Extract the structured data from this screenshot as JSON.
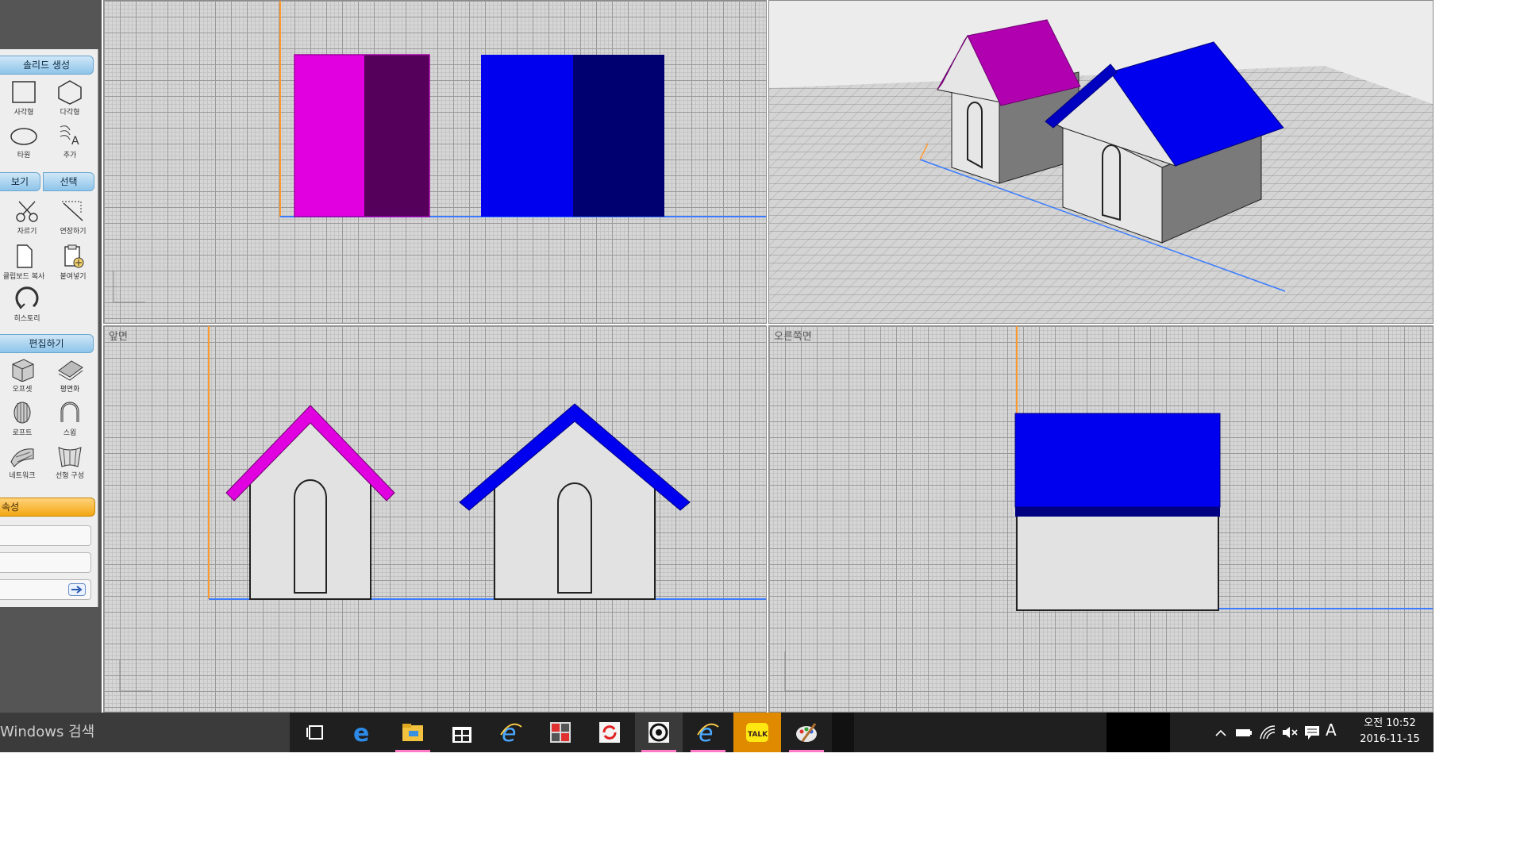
{
  "panel": {
    "solid_header": "솔리드 생성",
    "tools_solid": [
      {
        "label": "사각형",
        "icon": "rectangle-icon"
      },
      {
        "label": "다각형",
        "icon": "polygon-icon"
      },
      {
        "label": "타원",
        "icon": "ellipse-icon"
      },
      {
        "label": "추가",
        "icon": "add-text-icon"
      }
    ],
    "view_tab": "보기",
    "select_tab": "선택",
    "tools_view": [
      {
        "label": "자르기",
        "icon": "scissors-icon"
      },
      {
        "label": "연장하기",
        "icon": "extend-icon"
      },
      {
        "label": "클립보드 복사",
        "icon": "clipboard-copy-icon"
      },
      {
        "label": "붙여넣기",
        "icon": "paste-icon"
      },
      {
        "label": "히스토리",
        "icon": "history-icon"
      }
    ],
    "edit_header": "편집하기",
    "tools_edit": [
      {
        "label": "오프셋",
        "icon": "offset-icon"
      },
      {
        "label": "평면화",
        "icon": "flatten-icon"
      },
      {
        "label": "로프트",
        "icon": "loft-icon"
      },
      {
        "label": "스윕",
        "icon": "sweep-icon"
      },
      {
        "label": "네트워크",
        "icon": "network-icon"
      },
      {
        "label": "선형 구성",
        "icon": "linear-construct-icon"
      }
    ],
    "props_header": "속성"
  },
  "viewports": {
    "top": {
      "label": ""
    },
    "perspective": {
      "label": ""
    },
    "front": {
      "label": "앞면"
    },
    "right": {
      "label": "오른쪽면"
    }
  },
  "colors": {
    "magenta": "#e000e0",
    "magenta_dark": "#55005a",
    "blue": "#0000ee",
    "navy": "#000070",
    "wall": "#e2e2e2",
    "axis_orange": "#ff9a2e",
    "axis_blue": "#3b7cff"
  },
  "taskbar": {
    "search_text": "Windows 검색",
    "icons": [
      {
        "name": "task-view-icon"
      },
      {
        "name": "edge-icon"
      },
      {
        "name": "file-explorer-icon"
      },
      {
        "name": "store-icon"
      },
      {
        "name": "internet-explorer-icon"
      },
      {
        "name": "app-red-icon"
      },
      {
        "name": "sync-app-icon"
      },
      {
        "name": "modeler-app-icon"
      },
      {
        "name": "internet-explorer-2-icon"
      },
      {
        "name": "kakaotalk-icon",
        "text": "TALK"
      },
      {
        "name": "paint-icon"
      }
    ],
    "tray": {
      "ime": "A",
      "time": "오전 10:52",
      "date": "2016-11-15"
    }
  }
}
